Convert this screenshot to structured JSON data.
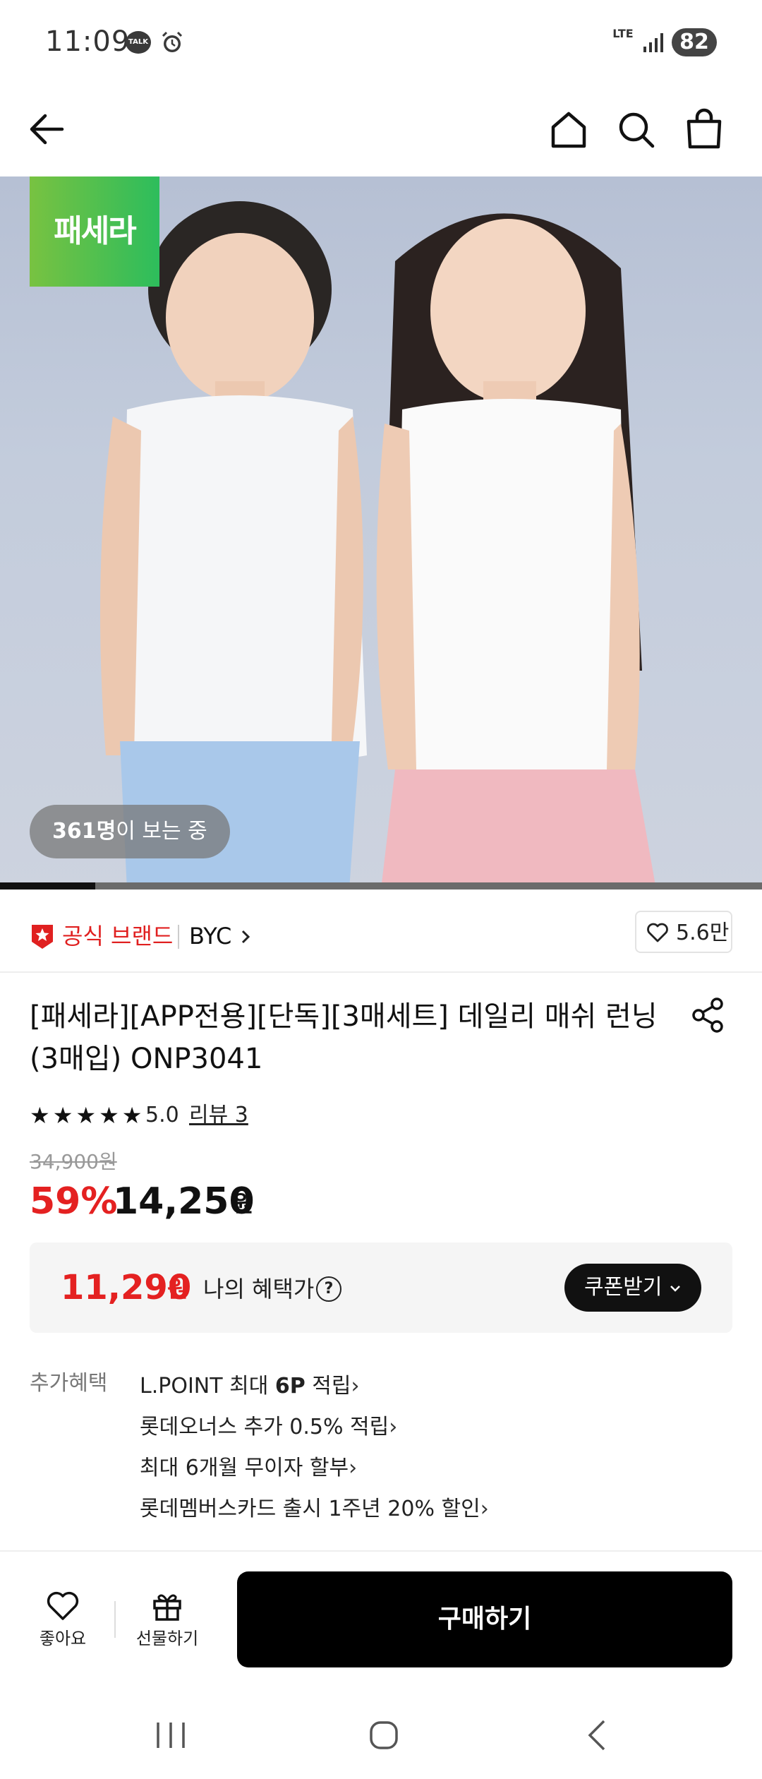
{
  "status_bar": {
    "time": "11:09",
    "talk_badge": "TALK",
    "network": "LTE",
    "battery": "82"
  },
  "hero": {
    "brand_badge": "패세라",
    "viewer_count": "361명",
    "viewer_suffix": "이 보는 중",
    "image_progress": 0.125
  },
  "brand": {
    "official_label": "공식 브랜드",
    "name": "BYC",
    "likes": "5.6만"
  },
  "product": {
    "title": "[패세라][APP전용][단독][3매세트] 데일리 매쉬 런닝 (3매입) ONP3041",
    "stars": "★★★★★",
    "rating": "5.0",
    "review_link": "리뷰 3",
    "original_price": "34,900원",
    "discount": "59%",
    "sale_price": "14,250",
    "sale_unit": "원"
  },
  "benefit": {
    "price": "11,290",
    "unit": "원",
    "label": "나의 혜택가",
    "help": "?",
    "coupon_button": "쿠폰받기"
  },
  "extra_benefits": {
    "label": "추가혜택",
    "items": [
      {
        "prefix": "L.POINT 최대 ",
        "bold": "6P",
        "suffix": " 적립"
      },
      {
        "prefix": "롯데오너스 추가 0.5% 적립",
        "bold": "",
        "suffix": ""
      },
      {
        "prefix": "최대 6개월 무이자 할부",
        "bold": "",
        "suffix": ""
      },
      {
        "prefix": "롯데멤버스카드 출시 1주년 20% 할인",
        "bold": "",
        "suffix": ""
      }
    ]
  },
  "bottom_bar": {
    "like_label": "좋아요",
    "gift_label": "선물하기",
    "buy_button": "구매하기"
  },
  "colors": {
    "accent_red": "#e42121",
    "brand_green": "#2dbd5c",
    "button_black": "#000000"
  },
  "icons": {
    "nav": [
      "back-arrow-icon",
      "home-icon",
      "search-icon",
      "shopping-bag-icon"
    ],
    "product": [
      "official-star-icon",
      "heart-icon",
      "share-icon"
    ],
    "bottom": [
      "heart-icon",
      "gift-icon"
    ],
    "system": [
      "recent-apps-icon",
      "home-circle-icon",
      "back-chevron-icon"
    ]
  }
}
